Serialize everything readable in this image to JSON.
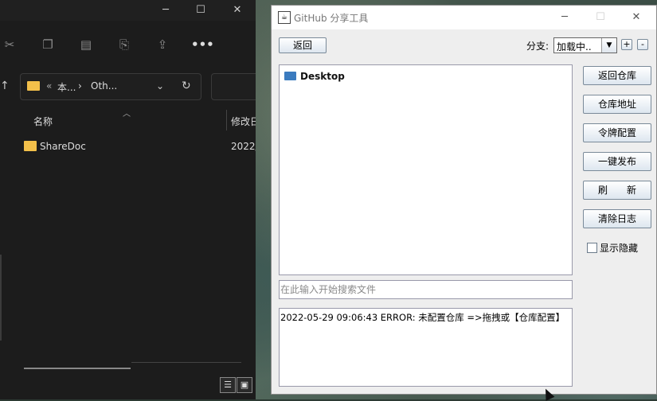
{
  "explorer": {
    "address_sep": "«",
    "address_part1": "本...",
    "address_chevron": "›",
    "address_part2": "Oth...",
    "column_name": "名称",
    "column_modified": "修改日",
    "rows": [
      {
        "name": "ShareDoc",
        "date": "2022/"
      }
    ]
  },
  "app": {
    "title": "GitHub 分享工具",
    "back_label": "返回",
    "branch_label": "分支:",
    "branch_value": "加载中..",
    "plus_label": "+",
    "minus_label": "-",
    "tree_root": "Desktop",
    "side_buttons": {
      "return_repo": "返回仓库",
      "repo_address": "仓库地址",
      "token_config": "令牌配置",
      "one_click_publish": "一键发布",
      "refresh": "刷　　新",
      "clear_log": "清除日志"
    },
    "show_hidden_label": "显示隐藏",
    "search_placeholder": "在此输入开始搜索文件",
    "log_lines": [
      "2022-05-29 09:06:43 ERROR: 未配置仓库 =>拖拽或【仓库配置】"
    ]
  },
  "icons": {
    "explorer": [
      "cut-icon",
      "copy-icon",
      "paste-icon",
      "rename-icon",
      "share-icon",
      "more-icon",
      "up-arrow-icon",
      "folder-icon",
      "refresh-icon",
      "minimize-icon",
      "maximize-icon",
      "close-icon",
      "details-view-icon",
      "tiles-view-icon"
    ],
    "app": [
      "java-app-icon",
      "minimize-icon",
      "maximize-icon",
      "close-icon",
      "dropdown-arrow-icon",
      "folder-icon",
      "checkbox-icon"
    ]
  },
  "colors": {
    "explorer_bg": "#1c1c1c",
    "folder_yellow": "#f3c04a",
    "tree_folder_blue": "#3b7bbf",
    "app_bg": "#eeeeee"
  }
}
